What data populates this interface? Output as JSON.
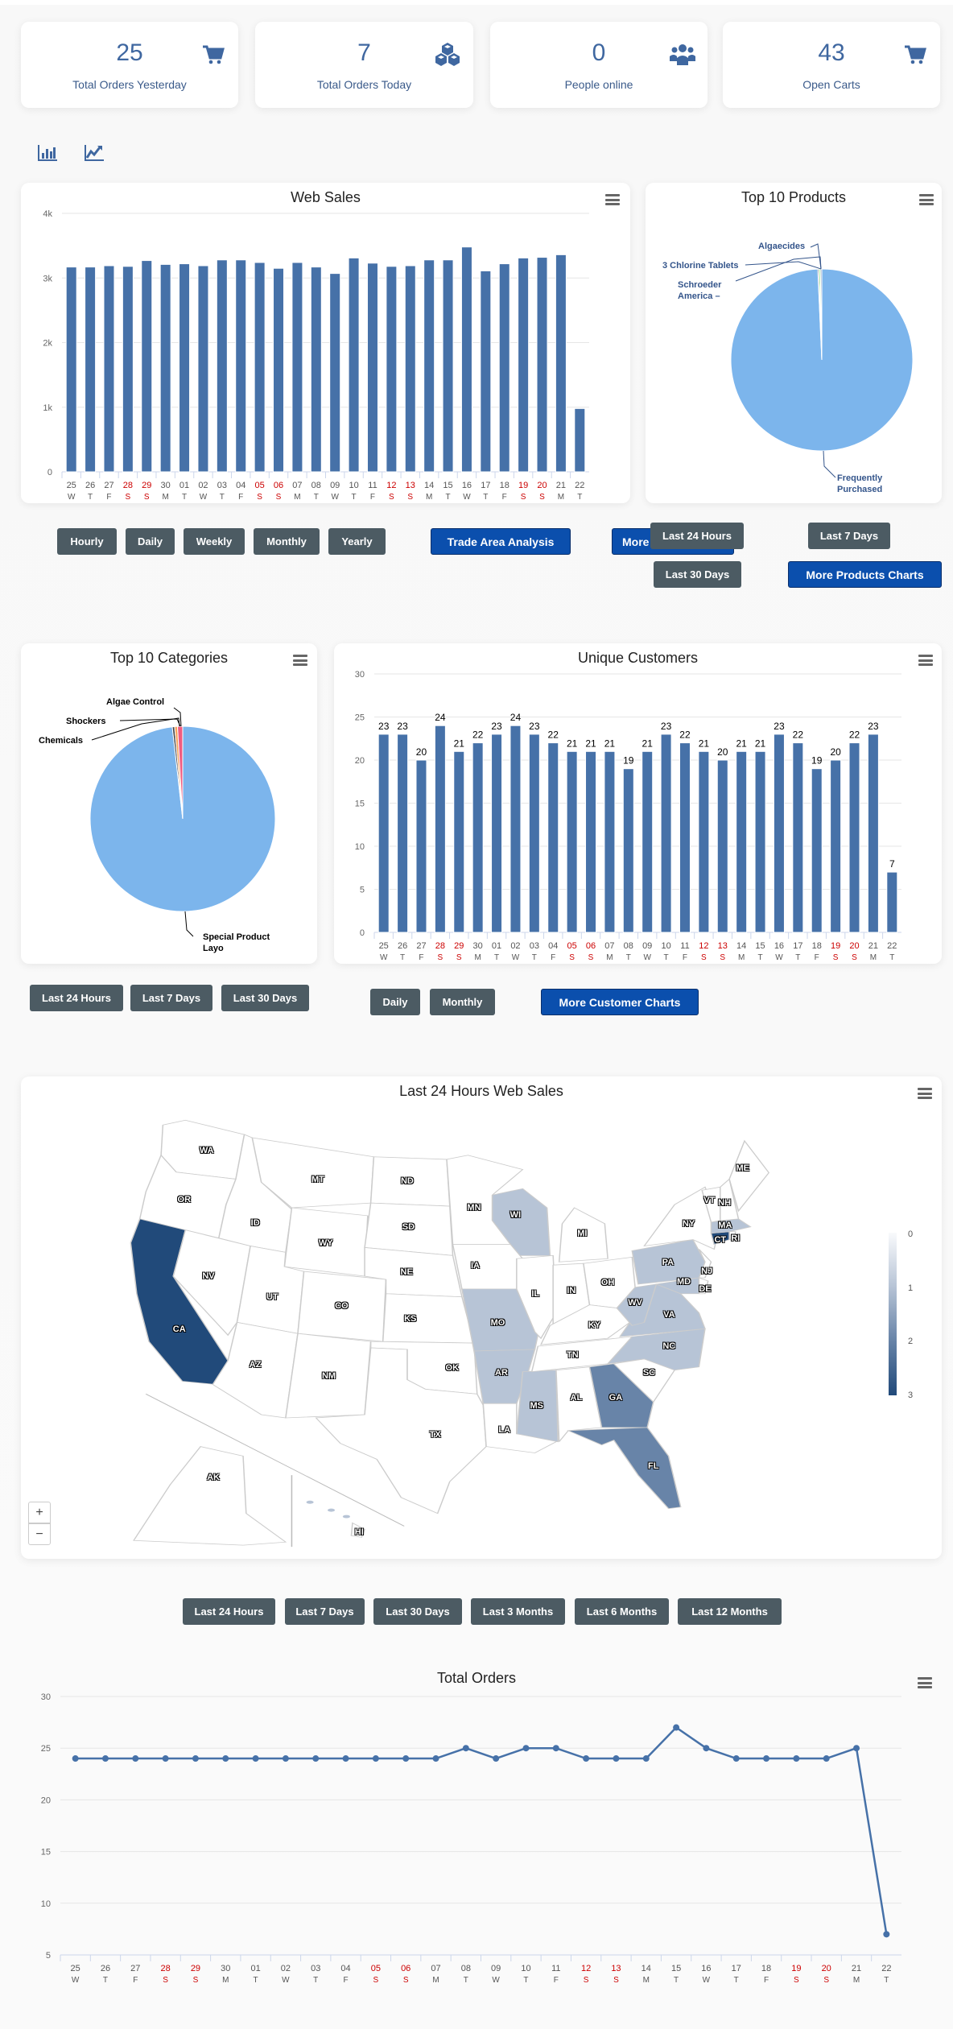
{
  "stats": [
    {
      "value": "25",
      "label": "Total Orders Yesterday",
      "icon": "shopping-cart-icon"
    },
    {
      "value": "7",
      "label": "Total Orders Today",
      "icon": "cubes-icon"
    },
    {
      "value": "0",
      "label": "People online",
      "icon": "users-icon"
    },
    {
      "value": "43",
      "label": "Open Carts",
      "icon": "shopping-cart-icon"
    }
  ],
  "chart_toggles": {
    "bar": "bar-chart-icon",
    "line": "line-chart-icon"
  },
  "colors": {
    "bar": "#4671a8",
    "pie_main": "#7cb5ec",
    "button_gray": "#4c5b63",
    "button_blue": "#0b4fad",
    "weekend": "#cc0000"
  },
  "sales_buttons": {
    "hourly": "Hourly",
    "daily": "Daily",
    "weekly": "Weekly",
    "monthly": "Monthly",
    "yearly": "Yearly",
    "trade_area": "Trade Area Analysis",
    "more": "More"
  },
  "products_buttons": {
    "last_24": "Last 24 Hours",
    "last_7": "Last 7 Days",
    "last_30": "Last 30 Days",
    "more": "More Products Charts"
  },
  "categories_buttons": {
    "last_24": "Last 24 Hours",
    "last_7": "Last 7 Days",
    "last_30": "Last 30 Days"
  },
  "customers_buttons": {
    "daily": "Daily",
    "monthly": "Monthly",
    "more": "More Customer Charts"
  },
  "orders_buttons": [
    "Last 24 Hours",
    "Last 7 Days",
    "Last 30 Days",
    "Last 3 Months",
    "Last 6 Months",
    "Last 12 Months"
  ],
  "chart_data": [
    {
      "id": "web_sales",
      "type": "bar",
      "title": "Web Sales",
      "categories": [
        "25",
        "26",
        "27",
        "28",
        "29",
        "30",
        "01",
        "02",
        "03",
        "04",
        "05",
        "06",
        "07",
        "08",
        "09",
        "10",
        "11",
        "12",
        "13",
        "14",
        "15",
        "16",
        "17",
        "18",
        "19",
        "20",
        "21",
        "22"
      ],
      "weekdays": [
        "W",
        "T",
        "F",
        "S",
        "S",
        "M",
        "T",
        "W",
        "T",
        "F",
        "S",
        "S",
        "M",
        "T",
        "W",
        "T",
        "F",
        "S",
        "S",
        "M",
        "T",
        "W",
        "T",
        "F",
        "S",
        "S",
        "M",
        "T"
      ],
      "values": [
        3170,
        3170,
        3190,
        3180,
        3270,
        3210,
        3220,
        3190,
        3280,
        3280,
        3240,
        3150,
        3240,
        3170,
        3070,
        3310,
        3230,
        3180,
        3190,
        3280,
        3280,
        3480,
        3110,
        3220,
        3310,
        3320,
        3360,
        980
      ],
      "ylim": [
        0,
        4000
      ],
      "yticks": [
        "0",
        "1k",
        "2k",
        "3k",
        "4k"
      ],
      "grid": true
    },
    {
      "id": "top_products",
      "type": "pie",
      "title": "Top 10 Products",
      "slices": [
        {
          "name": "Frequently Purchased",
          "value": 99.3
        },
        {
          "name": "Schroeder America –",
          "value": 0.2
        },
        {
          "name": "3 Chlorine Tablets",
          "value": 0.25
        },
        {
          "name": "Algaecides",
          "value": 0.25
        }
      ]
    },
    {
      "id": "top_categories",
      "type": "pie",
      "title": "Top 10 Categories",
      "slices": [
        {
          "name": "Special Product Layo",
          "value": 98.2
        },
        {
          "name": "Chemicals",
          "value": 0.4
        },
        {
          "name": "Shockers",
          "value": 0.5
        },
        {
          "name": "Algae Control",
          "value": 0.9
        }
      ]
    },
    {
      "id": "unique_customers",
      "type": "bar",
      "title": "Unique Customers",
      "categories": [
        "25",
        "26",
        "27",
        "28",
        "29",
        "30",
        "01",
        "02",
        "03",
        "04",
        "05",
        "06",
        "07",
        "08",
        "09",
        "10",
        "11",
        "12",
        "13",
        "14",
        "15",
        "16",
        "17",
        "18",
        "19",
        "20",
        "21",
        "22"
      ],
      "weekdays": [
        "W",
        "T",
        "F",
        "S",
        "S",
        "M",
        "T",
        "W",
        "T",
        "F",
        "S",
        "S",
        "M",
        "T",
        "W",
        "T",
        "F",
        "S",
        "S",
        "M",
        "T",
        "W",
        "T",
        "F",
        "S",
        "S",
        "M",
        "T"
      ],
      "values": [
        23,
        23,
        20,
        24,
        21,
        22,
        23,
        24,
        23,
        22,
        21,
        21,
        21,
        19,
        21,
        23,
        22,
        21,
        20,
        21,
        21,
        23,
        22,
        19,
        20,
        22,
        23,
        7
      ],
      "ylim": [
        0,
        30
      ],
      "yticks": [
        "0",
        "5",
        "10",
        "15",
        "20",
        "25",
        "30"
      ],
      "data_labels": true,
      "grid": true
    },
    {
      "id": "total_orders",
      "type": "line",
      "title": "Total Orders",
      "categories": [
        "25",
        "26",
        "27",
        "28",
        "29",
        "30",
        "01",
        "02",
        "03",
        "04",
        "05",
        "06",
        "07",
        "08",
        "09",
        "10",
        "11",
        "12",
        "13",
        "14",
        "15",
        "16",
        "17",
        "18",
        "19",
        "20",
        "21",
        "22"
      ],
      "weekdays": [
        "W",
        "T",
        "F",
        "S",
        "S",
        "M",
        "T",
        "W",
        "T",
        "F",
        "S",
        "S",
        "M",
        "T",
        "W",
        "T",
        "F",
        "S",
        "S",
        "M",
        "T",
        "W",
        "T",
        "F",
        "S",
        "S",
        "M",
        "T"
      ],
      "values": [
        24,
        24,
        24,
        24,
        24,
        24,
        24,
        24,
        24,
        24,
        24,
        24,
        24,
        25,
        24,
        25,
        25,
        24,
        24,
        24,
        27,
        25,
        24,
        24,
        24,
        24,
        25,
        7
      ],
      "ylim": [
        5,
        30
      ],
      "yticks": [
        "5",
        "10",
        "15",
        "20",
        "25",
        "30"
      ],
      "grid": true
    }
  ],
  "map": {
    "title": "Last 24 Hours Web Sales",
    "legend": [
      "0",
      "1",
      "2",
      "3"
    ],
    "zoom_in": "+",
    "zoom_out": "−",
    "values": {
      "CA": 3,
      "CT": 3,
      "GA": 2,
      "FL": 2,
      "MA": 1,
      "WI": 1,
      "MO": 1,
      "AR": 1,
      "MS": 1,
      "PA": 1,
      "WV": 1,
      "VA": 1,
      "NC": 1,
      "MD": 1
    },
    "states": [
      "WA",
      "OR",
      "CA",
      "NV",
      "ID",
      "MT",
      "WY",
      "UT",
      "CO",
      "AZ",
      "NM",
      "ND",
      "SD",
      "NE",
      "KS",
      "OK",
      "TX",
      "MN",
      "WI",
      "IA",
      "MO",
      "AR",
      "LA",
      "MS",
      "IL",
      "IN",
      "MI",
      "OH",
      "KY",
      "TN",
      "AL",
      "GA",
      "FL",
      "SC",
      "NC",
      "VA",
      "WV",
      "PA",
      "NY",
      "MD",
      "NJ",
      "DE",
      "CT",
      "RI",
      "MA",
      "VT",
      "NH",
      "ME",
      "AK",
      "HI"
    ]
  }
}
